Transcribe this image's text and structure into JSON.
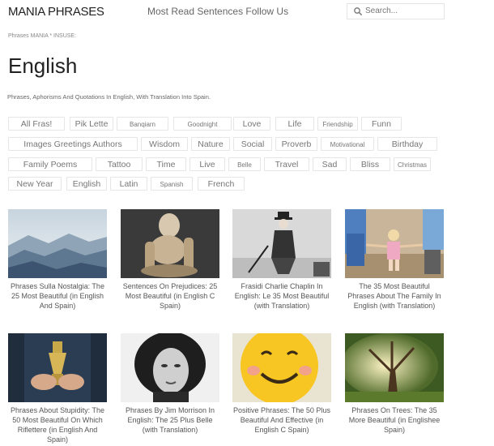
{
  "header": {
    "logo": "MANIA PHRASES",
    "nav_link": "Most Read Sentences Follow Us",
    "search_placeholder": "Search..."
  },
  "breadcrumb": "Phrases MANIA * INSUSE:",
  "page": {
    "title": "English",
    "subtitle": "Phrases, Aphorisms And Quotations In English, With Translation Into Spain."
  },
  "tags": [
    "All Fras!",
    "Pik Lette",
    "Banqiarn",
    "Goodnight",
    "Love",
    "Life",
    "Friendship",
    "Funn",
    "Images Greetings Authors",
    "Wisdom",
    "Nature",
    "Social",
    "Proverb",
    "Motivational",
    "Birthday",
    "Family Poems",
    "Tattoo",
    "Time",
    "Live",
    "Belle",
    "Travel",
    "Sad",
    "Bliss",
    "Christmas",
    "New Year",
    "English",
    "Latin",
    "Spanish",
    "French"
  ],
  "cards": [
    {
      "caption": "Phrases Sulla Nostalgia: The 25 Most Beautiful (in English And Spain)",
      "image": "misty-mountains-image"
    },
    {
      "caption": "Sentences On Prejudices: 25 Most Beautiful (in English C Spain)",
      "image": "wooden-mannequin-image"
    },
    {
      "caption": "Frasidi Charlie Chaplin In English: Le 35 Most Beautiful (with Translation)",
      "image": "charlie-chaplin-image"
    },
    {
      "caption": "The 35 Most Beautiful Phrases About The Family In English (with Translation)",
      "image": "family-walking-image"
    },
    {
      "caption": "Phrases About Stupidity: The 50 Most Beautiful On Which Riflettere (in English And Spain)",
      "image": "trophy-hands-image"
    },
    {
      "caption": "Phrases By Jim Morrison In English: The 25 Plus Belle (with Translation)",
      "image": "jim-morrison-image"
    },
    {
      "caption": "Positive Phrases: The 50 Plus Beautiful And Effective (in English C Spain)",
      "image": "smiley-face-image"
    },
    {
      "caption": "Phrases On Trees: The 35 More Beautiful (in Englishee Spain)",
      "image": "sunlit-tree-image"
    }
  ],
  "colors": {
    "text": "#333333",
    "muted": "#777777",
    "border": "#e6e6e6",
    "smiley": "#f7c623"
  }
}
